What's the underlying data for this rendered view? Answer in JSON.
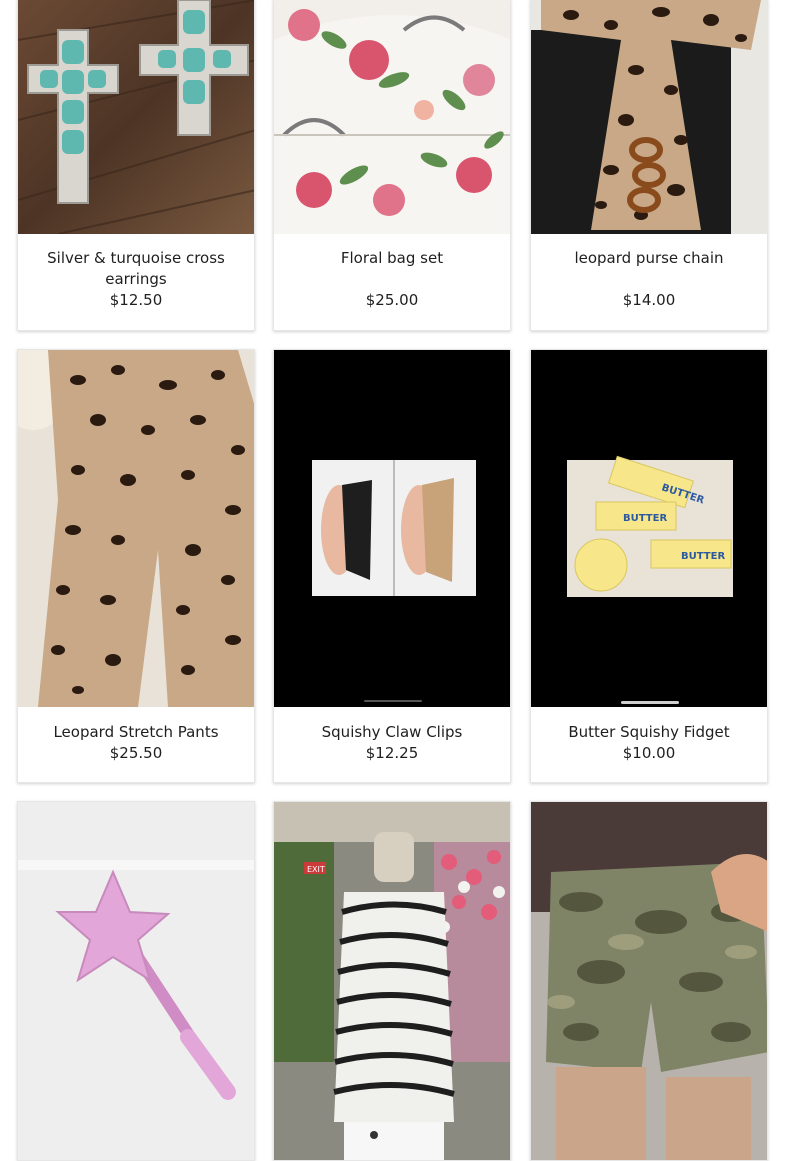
{
  "products": [
    {
      "title": "Silver & turquoise cross earrings",
      "price": "$12.50"
    },
    {
      "title": "Floral bag set",
      "price": "$25.00"
    },
    {
      "title": "leopard purse chain",
      "price": "$14.00"
    },
    {
      "title": "Leopard Stretch Pants",
      "price": "$25.50"
    },
    {
      "title": "Squishy Claw Clips",
      "price": "$12.25"
    },
    {
      "title": "Butter Squishy Fidget",
      "price": "$10.00"
    },
    {
      "title": "",
      "price": ""
    },
    {
      "title": "",
      "price": ""
    },
    {
      "title": "",
      "price": ""
    }
  ],
  "images": {
    "butter_label": "BUTTER",
    "exit_sign": "EXIT"
  },
  "colors": {
    "turquoise": "#5fb8b0",
    "leopard_base": "#c8a886",
    "leopard_spot": "#2a1a10",
    "wand_pink": "#e2a6d8",
    "butter_yellow": "#f7e78a"
  }
}
